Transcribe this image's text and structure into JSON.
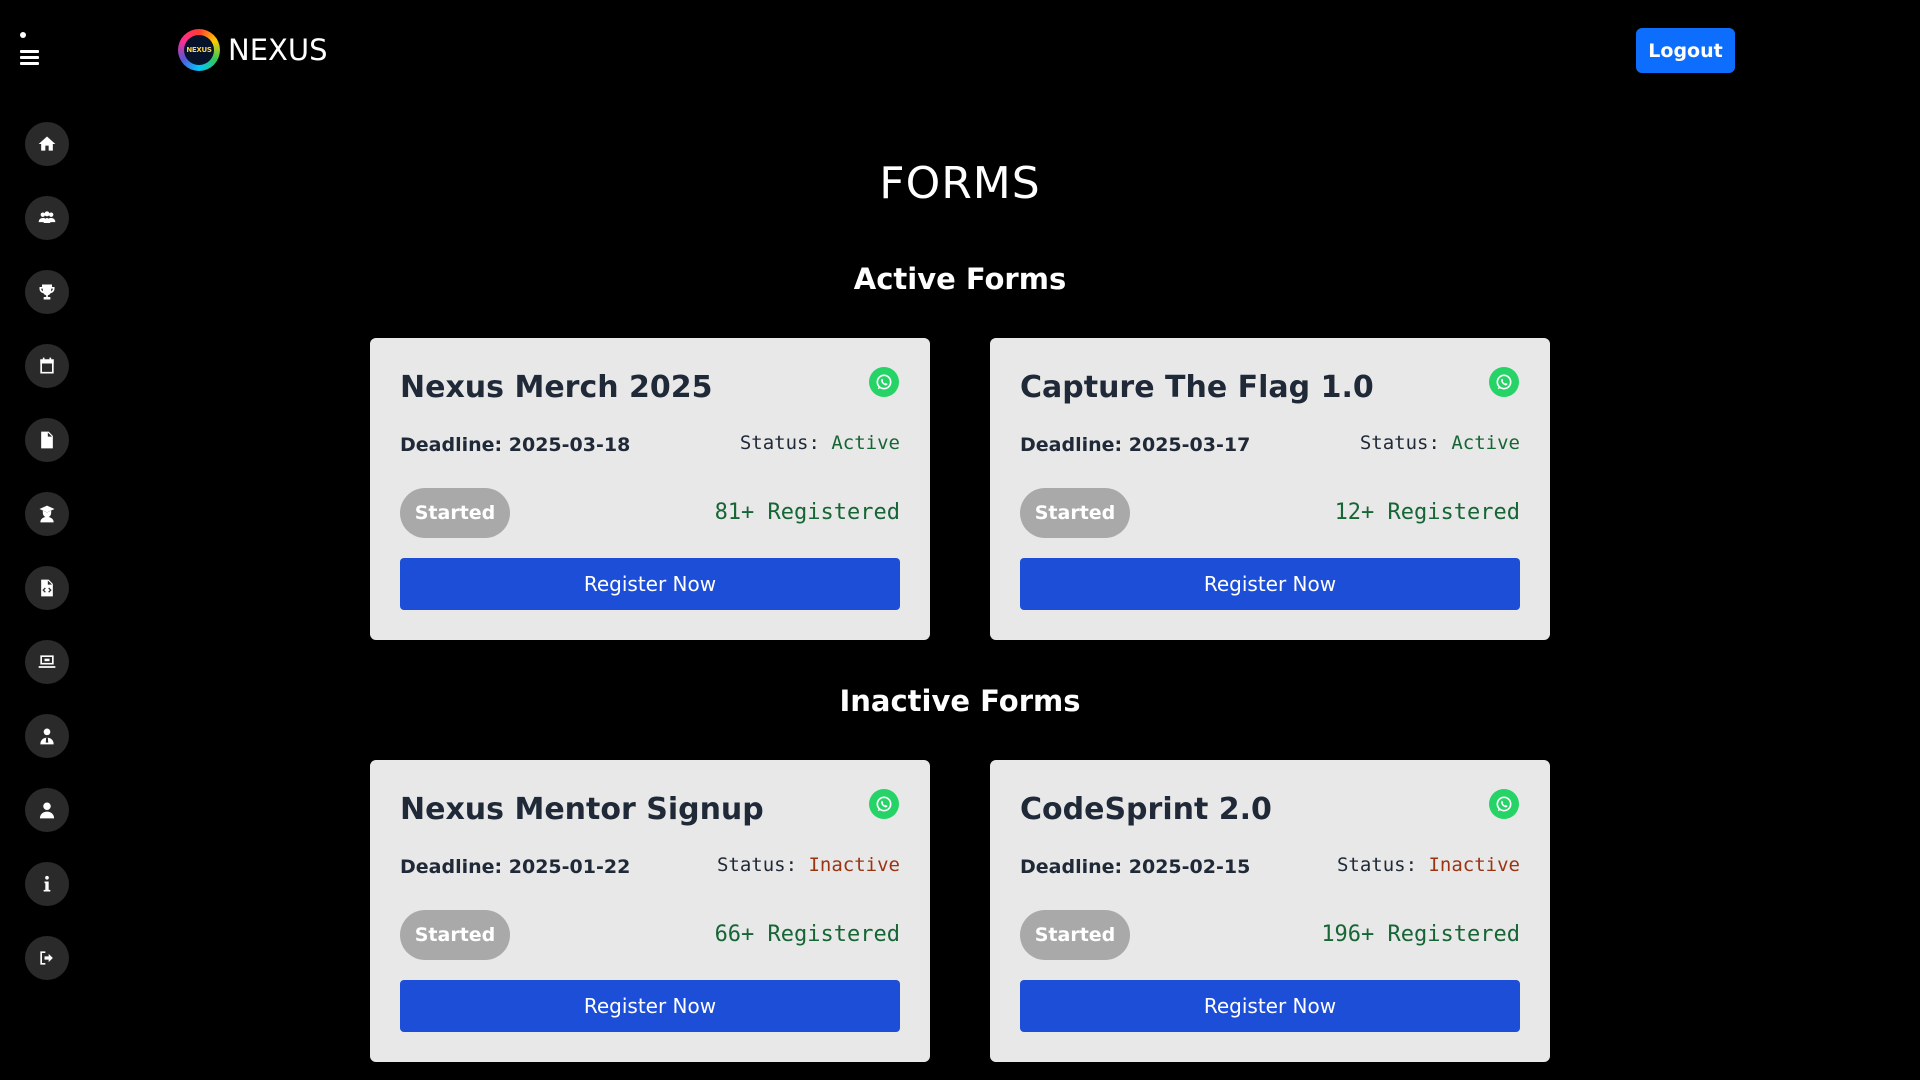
{
  "header": {
    "brand_name": "NEXUS",
    "logo_text": "NEXUS",
    "logout_label": "Logout"
  },
  "sidebar": {
    "items": [
      {
        "icon": "home-icon"
      },
      {
        "icon": "users-icon"
      },
      {
        "icon": "trophy-icon"
      },
      {
        "icon": "calendar-icon"
      },
      {
        "icon": "document-icon"
      },
      {
        "icon": "graduate-icon"
      },
      {
        "icon": "code-file-icon"
      },
      {
        "icon": "laptop-icon"
      },
      {
        "icon": "mentor-icon"
      },
      {
        "icon": "user-icon"
      },
      {
        "icon": "info-icon"
      },
      {
        "icon": "sign-out-icon"
      }
    ]
  },
  "main": {
    "title": "FORMS",
    "active_heading": "Active Forms",
    "inactive_heading": "Inactive Forms",
    "labels": {
      "deadline": "Deadline:",
      "status": "Status:",
      "started": "Started",
      "register": "Register Now"
    },
    "active_forms": [
      {
        "title": "Nexus Merch 2025",
        "deadline": "2025-03-18",
        "status": "Active",
        "registered": "81+ Registered"
      },
      {
        "title": "Capture The Flag 1.0",
        "deadline": "2025-03-17",
        "status": "Active",
        "registered": "12+ Registered"
      }
    ],
    "inactive_forms": [
      {
        "title": "Nexus Mentor Signup",
        "deadline": "2025-01-22",
        "status": "Inactive",
        "registered": "66+ Registered"
      },
      {
        "title": "CodeSprint 2.0",
        "deadline": "2025-02-15",
        "status": "Inactive",
        "registered": "196+ Registered"
      }
    ]
  },
  "colors": {
    "background": "#000000",
    "card": "#e8e8e8",
    "primary_button": "#1d4ed8",
    "logout_button": "#0d6efd",
    "active_status": "#166534",
    "inactive_status": "#9a3412",
    "whatsapp": "#25d366"
  }
}
